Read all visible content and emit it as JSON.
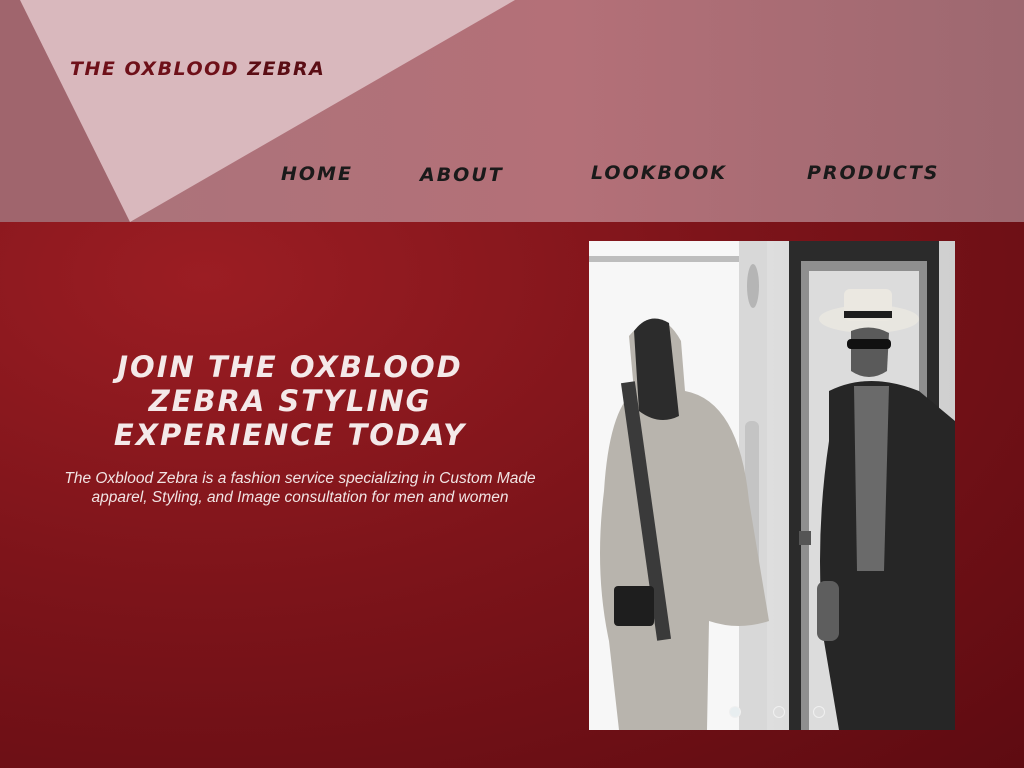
{
  "brand": {
    "word1": "THE OXBLOOD",
    "word2": "ZEBRA"
  },
  "nav": {
    "items": [
      {
        "label": "HOME"
      },
      {
        "label": "ABOUT"
      },
      {
        "label": "LOOKBOOK"
      },
      {
        "label": "PRODUCTS"
      }
    ]
  },
  "hero": {
    "title": "JOIN THE OXBLOOD ZEBRA STYLING EXPERIENCE TODAY",
    "description": "The Oxblood Zebra is a fashion service specializing in Custom Made apparel, Styling, and Image consultation for men and women"
  },
  "slideshow": {
    "slide_count": 3,
    "active_index": 0
  },
  "colors": {
    "header_bg": "#b47078",
    "hero_bg": "#7d141a",
    "brand_text": "#6e1019",
    "nav_text": "#1a1a1a",
    "hero_text": "#f4e9e9"
  },
  "icons": [
    "slide-dot-icon"
  ]
}
